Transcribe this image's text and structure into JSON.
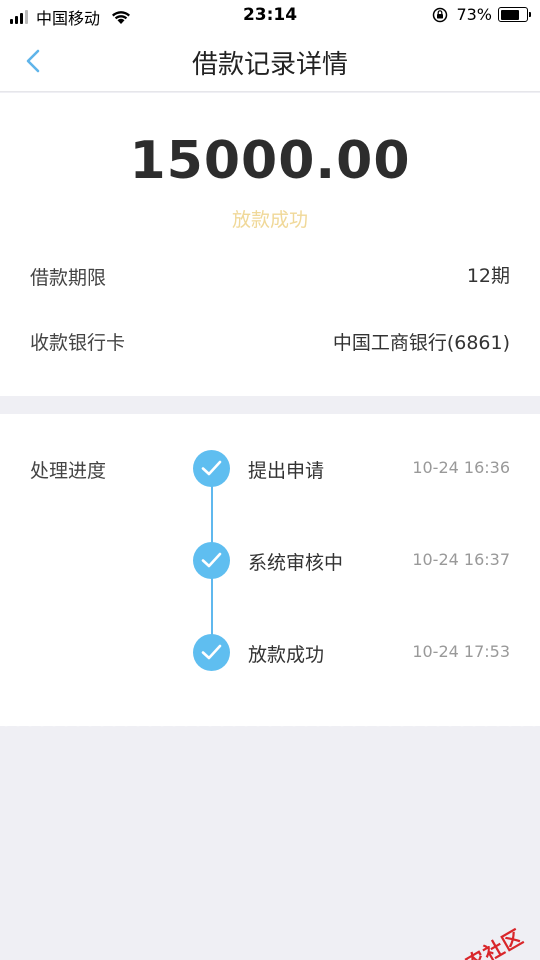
{
  "status_bar": {
    "carrier": "中国移动",
    "time": "23:14",
    "battery_pct": "73%",
    "battery_level": 0.73
  },
  "nav": {
    "title": "借款记录详情"
  },
  "summary": {
    "amount": "15000.00",
    "status": "放款成功",
    "term_label": "借款期限",
    "term_value": "12期",
    "bank_label": "收款银行卡",
    "bank_value": "中国工商银行(6861)"
  },
  "progress": {
    "label": "处理进度",
    "steps": [
      {
        "name": "提出申请",
        "time": "10-24 16:36"
      },
      {
        "name": "系统审核中",
        "time": "10-24 16:37"
      },
      {
        "name": "放款成功",
        "time": "10-24 17:53"
      }
    ]
  },
  "watermark": {
    "text": "卡农社区"
  },
  "colors": {
    "accent_blue": "#5fbef0",
    "status_gold": "#f0d898",
    "background": "#efeff4"
  }
}
